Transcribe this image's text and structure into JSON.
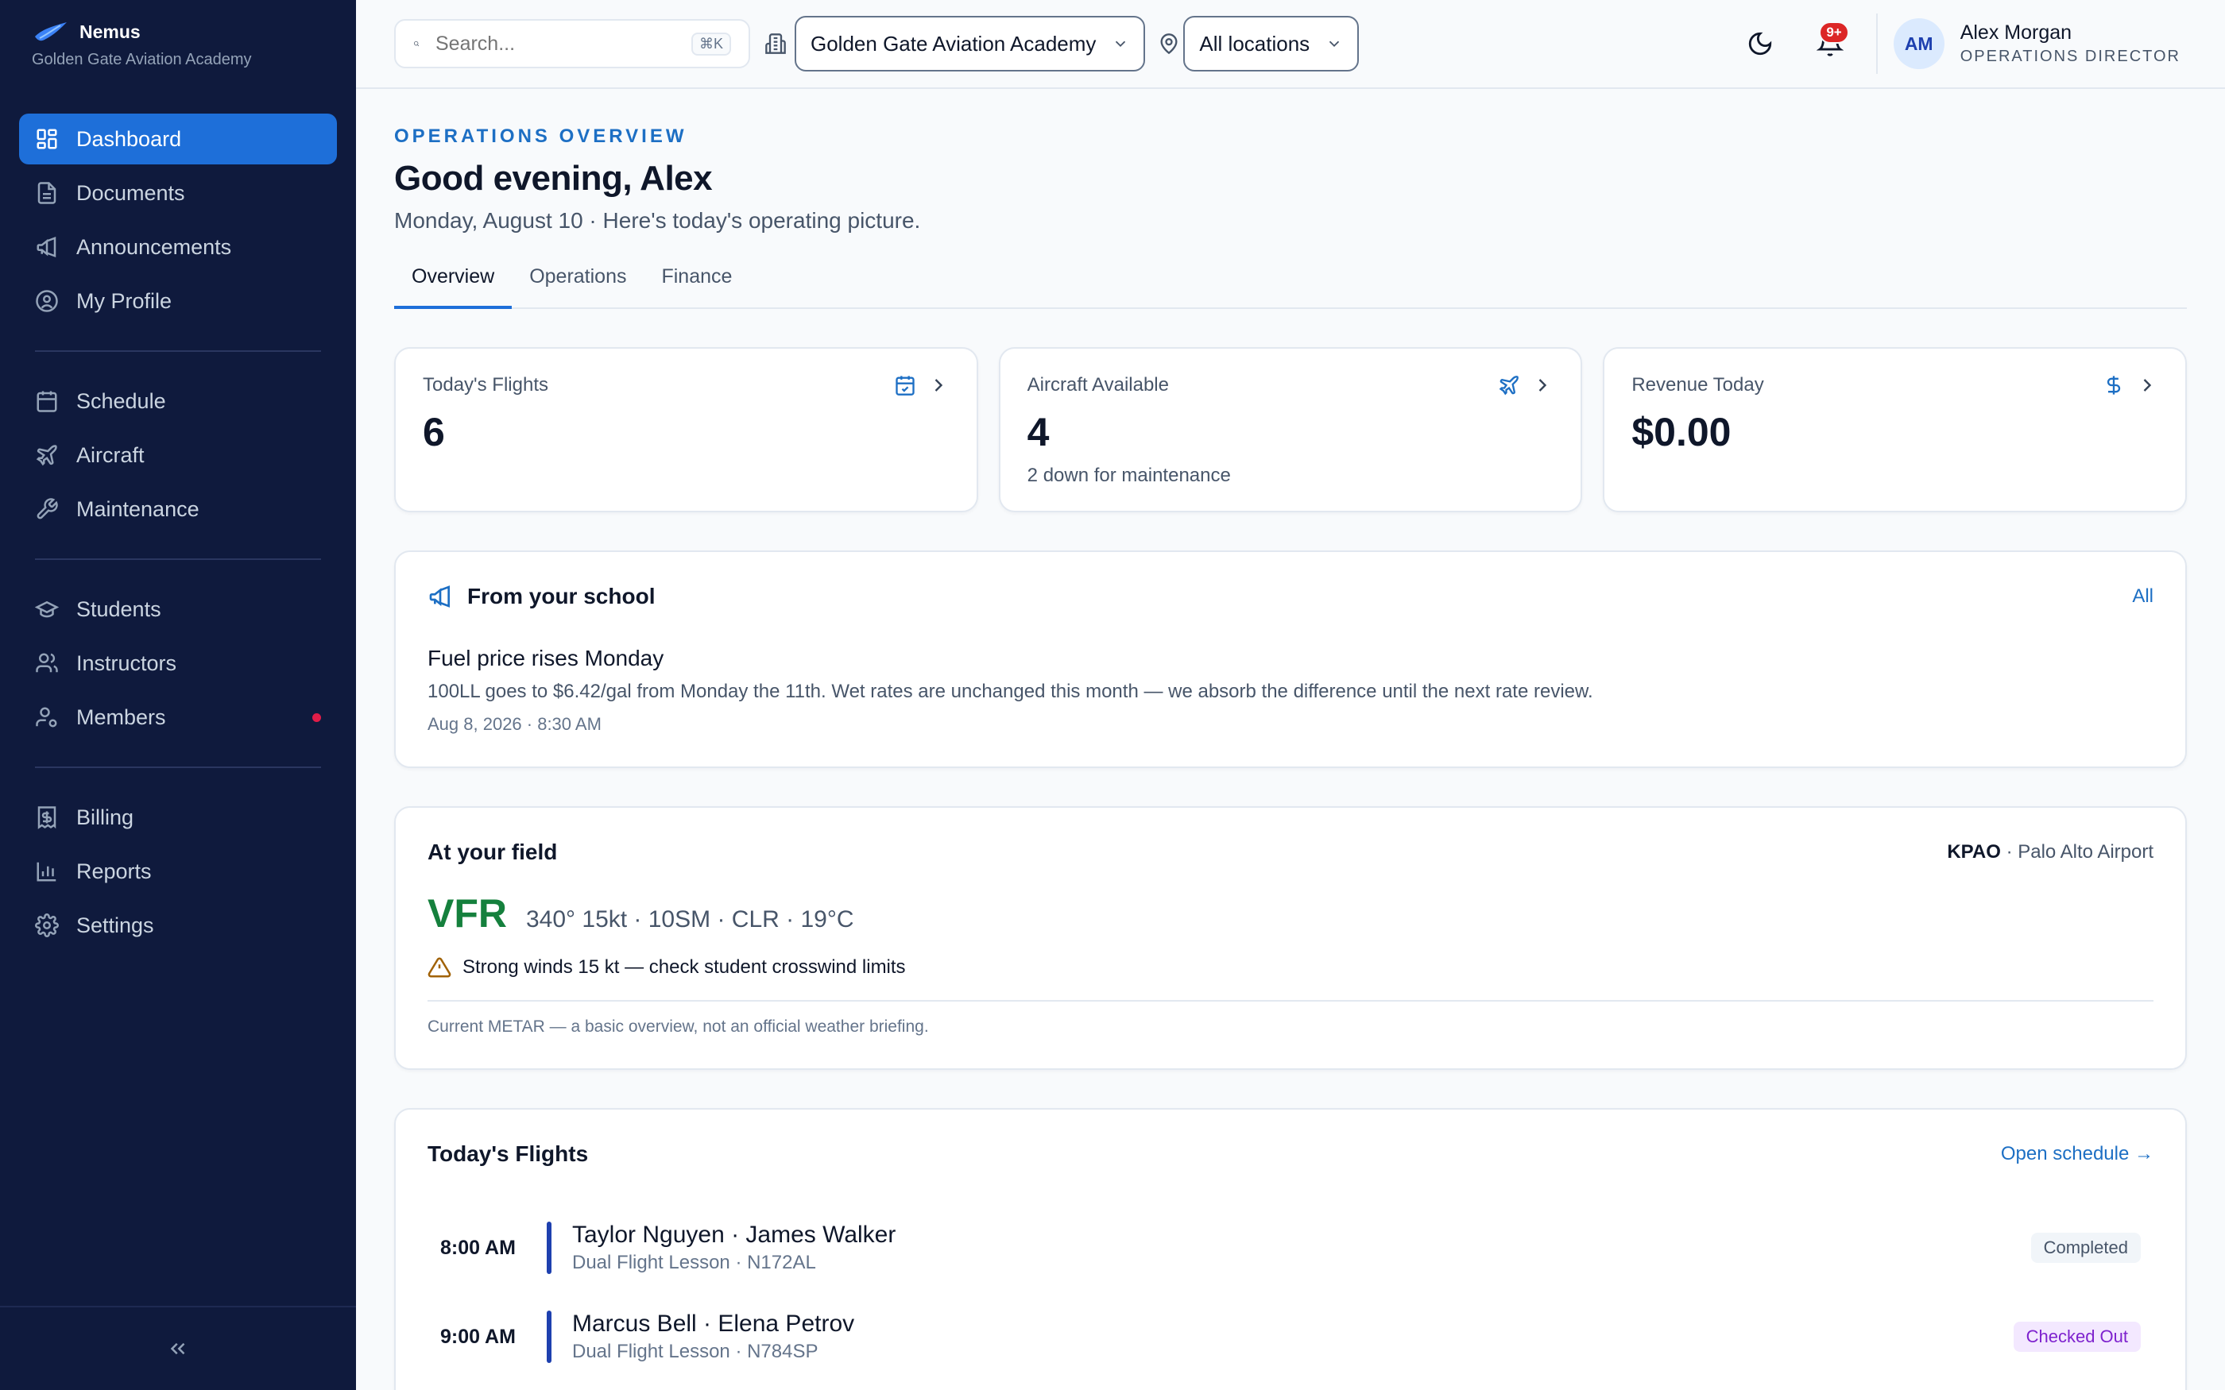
{
  "brand": {
    "name": "Nemus",
    "school": "Golden Gate Aviation Academy"
  },
  "sidebar": {
    "groups": [
      [
        {
          "label": "Dashboard",
          "icon": "dashboard-icon",
          "active": true
        },
        {
          "label": "Documents",
          "icon": "document-icon"
        },
        {
          "label": "Announcements",
          "icon": "megaphone-icon"
        },
        {
          "label": "My Profile",
          "icon": "profile-icon"
        }
      ],
      [
        {
          "label": "Schedule",
          "icon": "calendar-icon"
        },
        {
          "label": "Aircraft",
          "icon": "plane-icon"
        },
        {
          "label": "Maintenance",
          "icon": "wrench-icon"
        }
      ],
      [
        {
          "label": "Students",
          "icon": "graduation-cap-icon"
        },
        {
          "label": "Instructors",
          "icon": "users-icon"
        },
        {
          "label": "Members",
          "icon": "user-settings-icon",
          "dot": true
        }
      ],
      [
        {
          "label": "Billing",
          "icon": "receipt-icon"
        },
        {
          "label": "Reports",
          "icon": "bar-chart-icon"
        },
        {
          "label": "Settings",
          "icon": "gear-icon"
        }
      ]
    ],
    "collapse_icon": "chevrons-left-icon"
  },
  "topbar": {
    "search_placeholder": "Search...",
    "search_shortcut": "⌘K",
    "school_select": "Golden Gate Aviation Academy",
    "location_select": "All locations",
    "notifications_badge": "9+",
    "user": {
      "initials": "AM",
      "name": "Alex Morgan",
      "role": "OPERATIONS DIRECTOR"
    }
  },
  "header": {
    "eyebrow": "OPERATIONS OVERVIEW",
    "greeting": "Good evening, Alex",
    "subline": "Monday, August 10 · Here's today's operating picture."
  },
  "tabs": [
    {
      "label": "Overview",
      "active": true
    },
    {
      "label": "Operations"
    },
    {
      "label": "Finance"
    }
  ],
  "stats": [
    {
      "label": "Today's Flights",
      "value": "6",
      "note": "",
      "icon": "calendar-check-icon"
    },
    {
      "label": "Aircraft Available",
      "value": "4",
      "note": "2 down for maintenance",
      "icon": "plane-icon"
    },
    {
      "label": "Revenue Today",
      "value": "$0.00",
      "note": "",
      "icon": "dollar-icon"
    }
  ],
  "announcements": {
    "title": "From your school",
    "link": "All",
    "item": {
      "title": "Fuel price rises Monday",
      "body": "100LL goes to $6.42/gal from Monday the 11th. Wet rates are unchanged this month — we absorb the difference until the next rate review.",
      "date": "Aug 8, 2026 · 8:30 AM"
    }
  },
  "weather": {
    "title": "At your field",
    "airport_code": "KPAO",
    "airport_sep": " · ",
    "airport_name": "Palo Alto Airport",
    "category": "VFR",
    "metar": "340° 15kt · 10SM · CLR · 19°C",
    "warning": "Strong winds 15 kt — check student crosswind limits",
    "disclaimer": "Current METAR — a basic overview, not an official weather briefing.",
    "category_color": "#15803d"
  },
  "flights": {
    "title": "Today's Flights",
    "link": "Open schedule →",
    "rows": [
      {
        "time": "8:00 AM",
        "names": "Taylor Nguyen · James Walker",
        "detail": "Dual Flight Lesson · N172AL",
        "status": "Completed",
        "status_kind": "done"
      },
      {
        "time": "9:00 AM",
        "names": "Marcus Bell · Elena Petrov",
        "detail": "Dual Flight Lesson · N784SP",
        "status": "Checked Out",
        "status_kind": "out"
      }
    ]
  },
  "colors": {
    "sidebar": "#0f1a3d",
    "accent": "#1e6fd9",
    "vfr": "#15803d"
  }
}
